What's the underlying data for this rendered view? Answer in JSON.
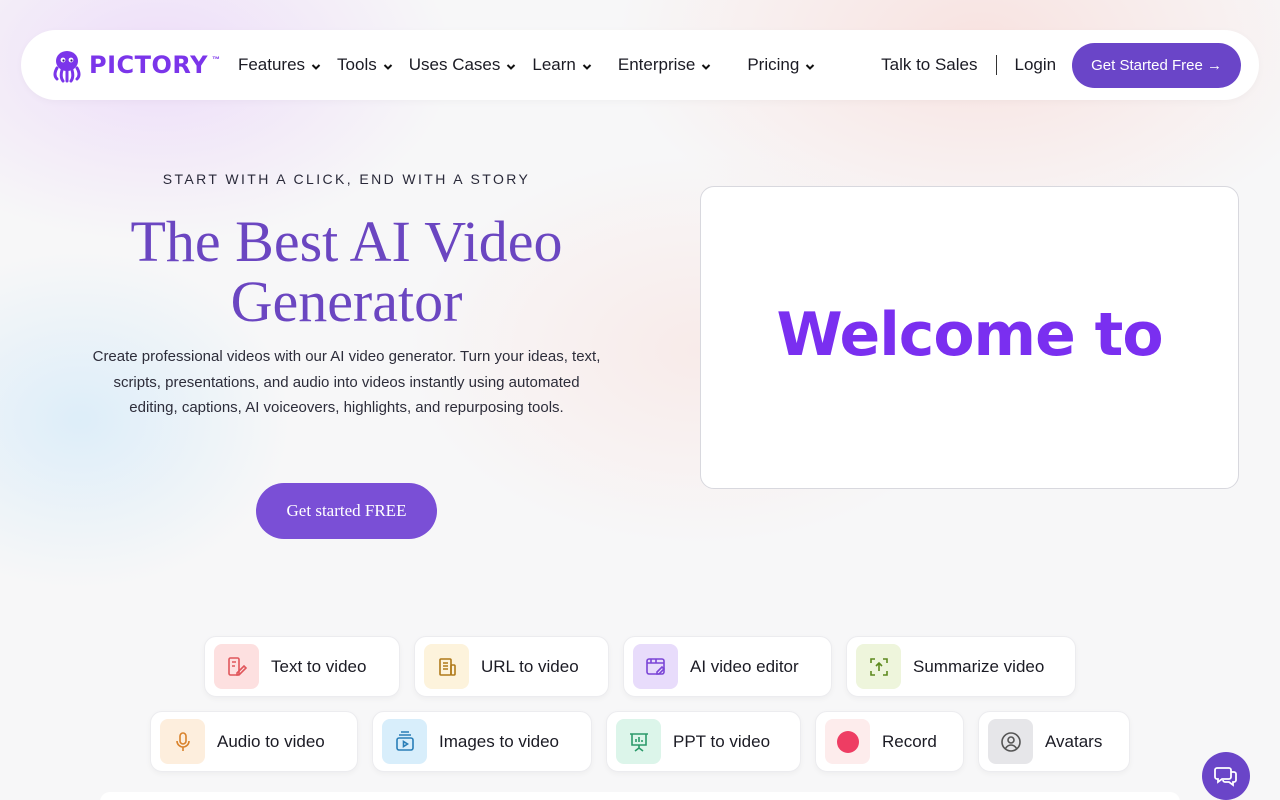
{
  "brand": {
    "name": "PICTORY",
    "tm": "™"
  },
  "nav": {
    "items": [
      {
        "label": "Features"
      },
      {
        "label": "Tools"
      },
      {
        "label": "Uses Cases"
      },
      {
        "label": "Learn"
      },
      {
        "label": "Enterprise"
      },
      {
        "label": "Pricing"
      }
    ],
    "talk_to_sales": "Talk to Sales",
    "login": "Login",
    "cta": "Get Started Free →"
  },
  "hero": {
    "eyebrow": "START WITH A CLICK, END WITH A STORY",
    "title_line1": "The Best AI Video",
    "title_line2": "Generator",
    "description": "Create professional videos with our AI video generator. Turn your ideas, text, scripts, presentations, and audio into videos instantly using automated editing, captions, AI voiceovers, highlights, and repurposing tools.",
    "cta": "Get started FREE",
    "video_text": "Welcome to"
  },
  "tools": [
    {
      "label": "Text to video",
      "icon": "text-edit-icon",
      "bg": "#fde0e0",
      "color": "#e0565b"
    },
    {
      "label": "URL to video",
      "icon": "document-icon",
      "bg": "#fdf3dc",
      "color": "#b07a1a"
    },
    {
      "label": "AI video editor",
      "icon": "editor-icon",
      "bg": "#e8dcfb",
      "color": "#7b45d6"
    },
    {
      "label": "Summarize video",
      "icon": "summarize-icon",
      "bg": "#eef5dc",
      "color": "#5d8a1f"
    },
    {
      "label": "Audio to video",
      "icon": "microphone-icon",
      "bg": "#fdeedd",
      "color": "#d9822b"
    },
    {
      "label": "Images to video",
      "icon": "images-icon",
      "bg": "#d8eefb",
      "color": "#2a7fb8"
    },
    {
      "label": "PPT to video",
      "icon": "presentation-icon",
      "bg": "#dcf5ea",
      "color": "#2b9a6a"
    },
    {
      "label": "Record",
      "icon": "record-icon",
      "bg": "#fdecec",
      "color": "#ee3d63"
    },
    {
      "label": "Avatars",
      "icon": "avatar-icon",
      "bg": "#ececee",
      "color": "#555"
    }
  ],
  "colors": {
    "accent": "#6a45c8",
    "headline": "#6b46c1",
    "brand": "#7b35ea"
  }
}
